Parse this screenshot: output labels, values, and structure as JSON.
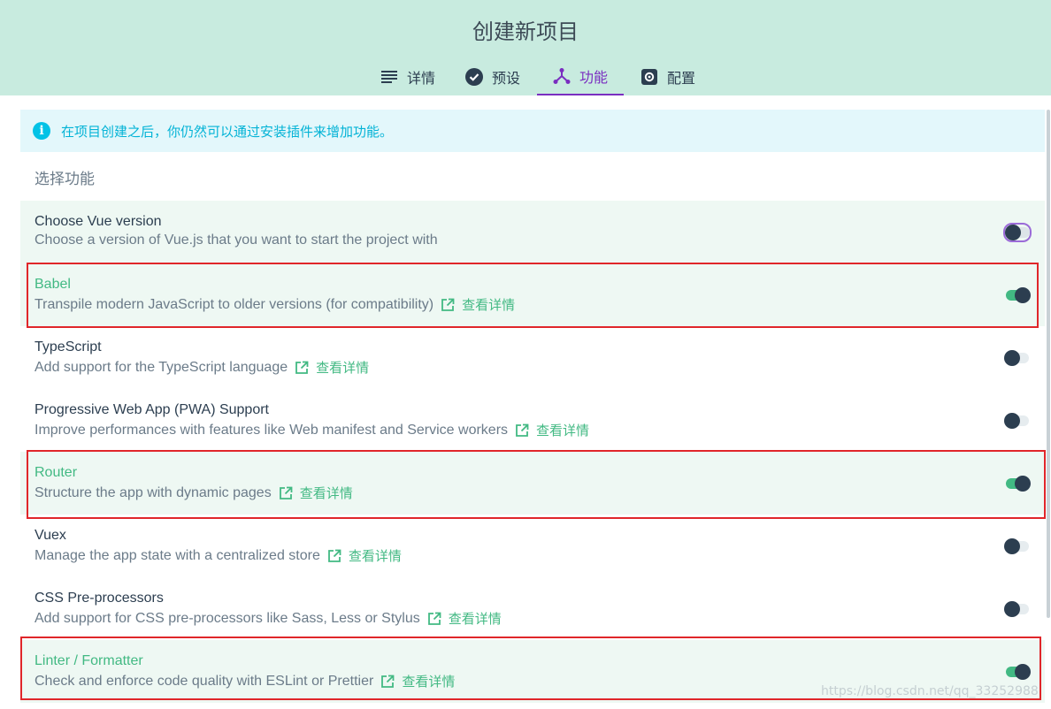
{
  "header": {
    "title": "创建新项目",
    "tabs": [
      {
        "label": "详情",
        "icon": "list-icon"
      },
      {
        "label": "预设",
        "icon": "check-circle-icon"
      },
      {
        "label": "功能",
        "icon": "merge-icon",
        "active": true
      },
      {
        "label": "配置",
        "icon": "gear-icon"
      }
    ]
  },
  "info": {
    "text": "在项目创建之后，你仍然可以通过安装插件来增加功能。"
  },
  "section_title": "选择功能",
  "link_label": "查看详情",
  "features": [
    {
      "name": "Choose Vue version",
      "description": "Choose a version of Vue.js that you want to start the project with",
      "enabled": false
    },
    {
      "name": "Babel",
      "description": "Transpile modern JavaScript to older versions (for compatibility)",
      "enabled": true
    },
    {
      "name": "TypeScript",
      "description": "Add support for the TypeScript language",
      "enabled": false
    },
    {
      "name": "Progressive Web App (PWA) Support",
      "description": "Improve performances with features like Web manifest and Service workers",
      "enabled": false
    },
    {
      "name": "Router",
      "description": "Structure the app with dynamic pages",
      "enabled": true
    },
    {
      "name": "Vuex",
      "description": "Manage the app state with a centralized store",
      "enabled": false
    },
    {
      "name": "CSS Pre-processors",
      "description": "Add support for CSS pre-processors like Sass, Less or Stylus",
      "enabled": false
    },
    {
      "name": "Linter / Formatter",
      "description": "Check and enforce code quality with ESLint or Prettier",
      "enabled": true
    }
  ],
  "watermark": "https://blog.csdn.net/qq_33252988",
  "colors": {
    "header_bg": "#c8ebdf",
    "accent_green": "#42b983",
    "active_tab": "#7a2ec0",
    "highlight_border": "#e0262a",
    "info_blue": "#03b3d6"
  }
}
